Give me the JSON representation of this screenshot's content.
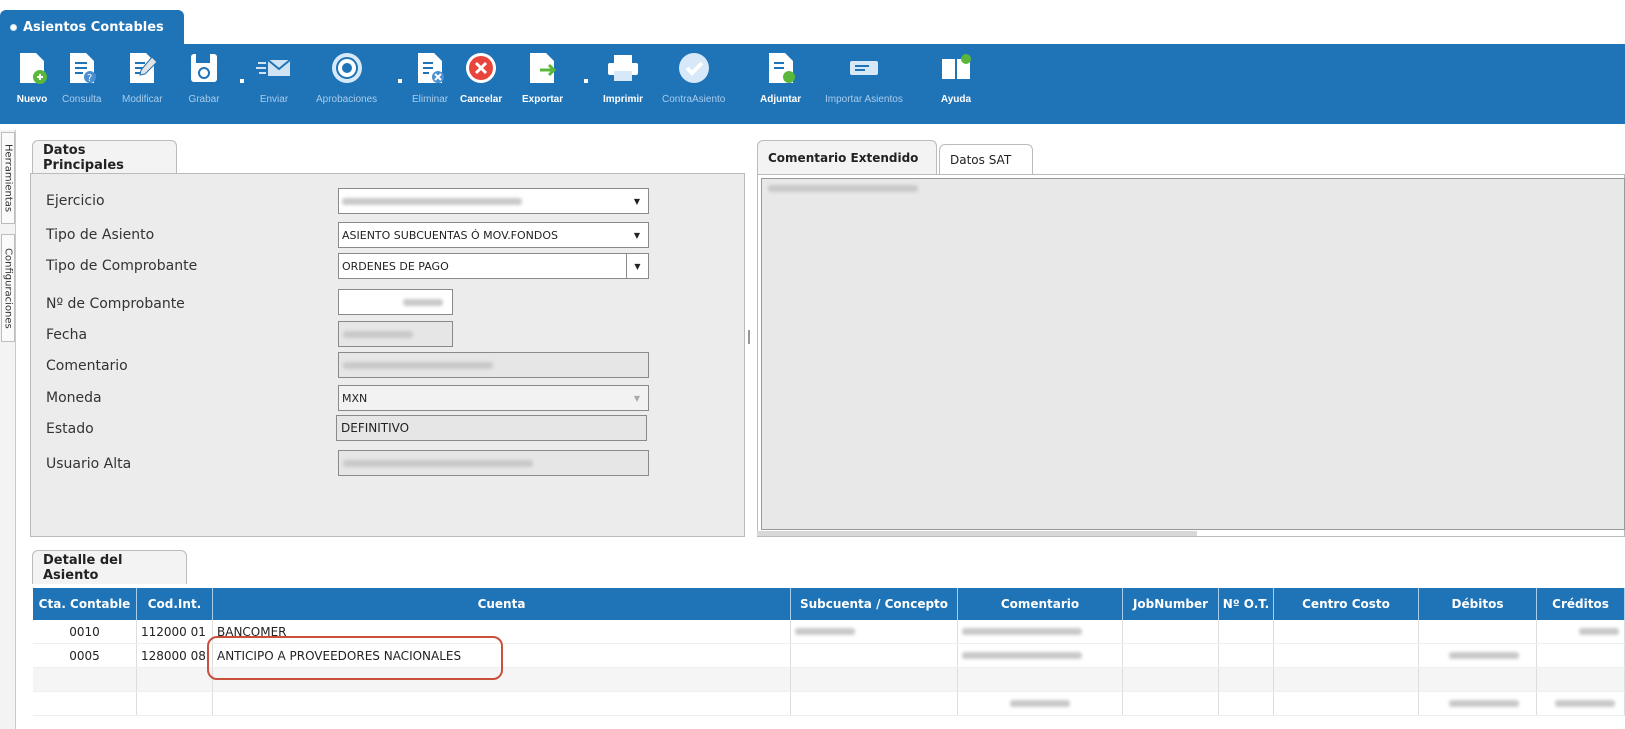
{
  "window": {
    "tab_title": "Asientos Contables"
  },
  "toolbar": {
    "items": [
      {
        "label": "Nuevo",
        "icon": "new-doc-icon",
        "bold": true
      },
      {
        "label": "Consulta",
        "icon": "query-doc-icon",
        "bold": false
      },
      {
        "label": "Modificar",
        "icon": "edit-doc-icon",
        "bold": false
      },
      {
        "label": "Grabar",
        "icon": "save-icon",
        "bold": false
      },
      {
        "label": "Enviar",
        "icon": "send-mail-icon",
        "bold": false
      },
      {
        "label": "Aprobaciones",
        "icon": "approvals-icon",
        "bold": false
      },
      {
        "label": "Eliminar",
        "icon": "delete-doc-icon",
        "bold": false
      },
      {
        "label": "Cancelar",
        "icon": "cancel-icon",
        "bold": true
      },
      {
        "label": "Exportar",
        "icon": "export-icon",
        "bold": true
      },
      {
        "label": "Imprimir",
        "icon": "print-icon",
        "bold": true
      },
      {
        "label": "ContraAsiento",
        "icon": "check-icon",
        "bold": false
      },
      {
        "label": "Adjuntar",
        "icon": "attach-icon",
        "bold": true
      },
      {
        "label": "Importar Asientos",
        "icon": "import-icon",
        "bold": false
      },
      {
        "label": "Ayuda",
        "icon": "help-book-icon",
        "bold": true
      }
    ]
  },
  "side_tabs": {
    "tools": "Herramientas",
    "config": "Configuraciones"
  },
  "datos_principales": {
    "tab_label": "Datos Principales",
    "fields": {
      "ejercicio": {
        "label": "Ejercicio"
      },
      "tipo_asiento": {
        "label": "Tipo de Asiento",
        "value": "ASIENTO SUBCUENTAS Ó MOV.FONDOS"
      },
      "tipo_comprobante": {
        "label": "Tipo de Comprobante",
        "value": "ORDENES DE PAGO"
      },
      "num_comprobante": {
        "label": "Nº de Comprobante"
      },
      "fecha": {
        "label": "Fecha"
      },
      "comentario": {
        "label": "Comentario"
      },
      "moneda": {
        "label": "Moneda",
        "value": "MXN"
      },
      "estado": {
        "label": "Estado",
        "value": "DEFINITIVO"
      },
      "usuario_alta": {
        "label": "Usuario Alta"
      }
    }
  },
  "right_tabs": {
    "comentario_ext": "Comentario Extendido",
    "datos_sat": "Datos SAT"
  },
  "detalle": {
    "tab_label": "Detalle del Asiento",
    "columns": [
      "Cta. Contable",
      "Cod.Int.",
      "Cuenta",
      "Subcuenta / Concepto",
      "Comentario",
      "JobNumber",
      "Nº O.T.",
      "Centro Costo",
      "Débitos",
      "Créditos"
    ],
    "rows": [
      {
        "cta": "0010",
        "cod": "112000 01",
        "cuenta": "BANCOMER"
      },
      {
        "cta": "0005",
        "cod": "128000 08",
        "cuenta": "ANTICIPO A PROVEEDORES NACIONALES"
      }
    ]
  }
}
